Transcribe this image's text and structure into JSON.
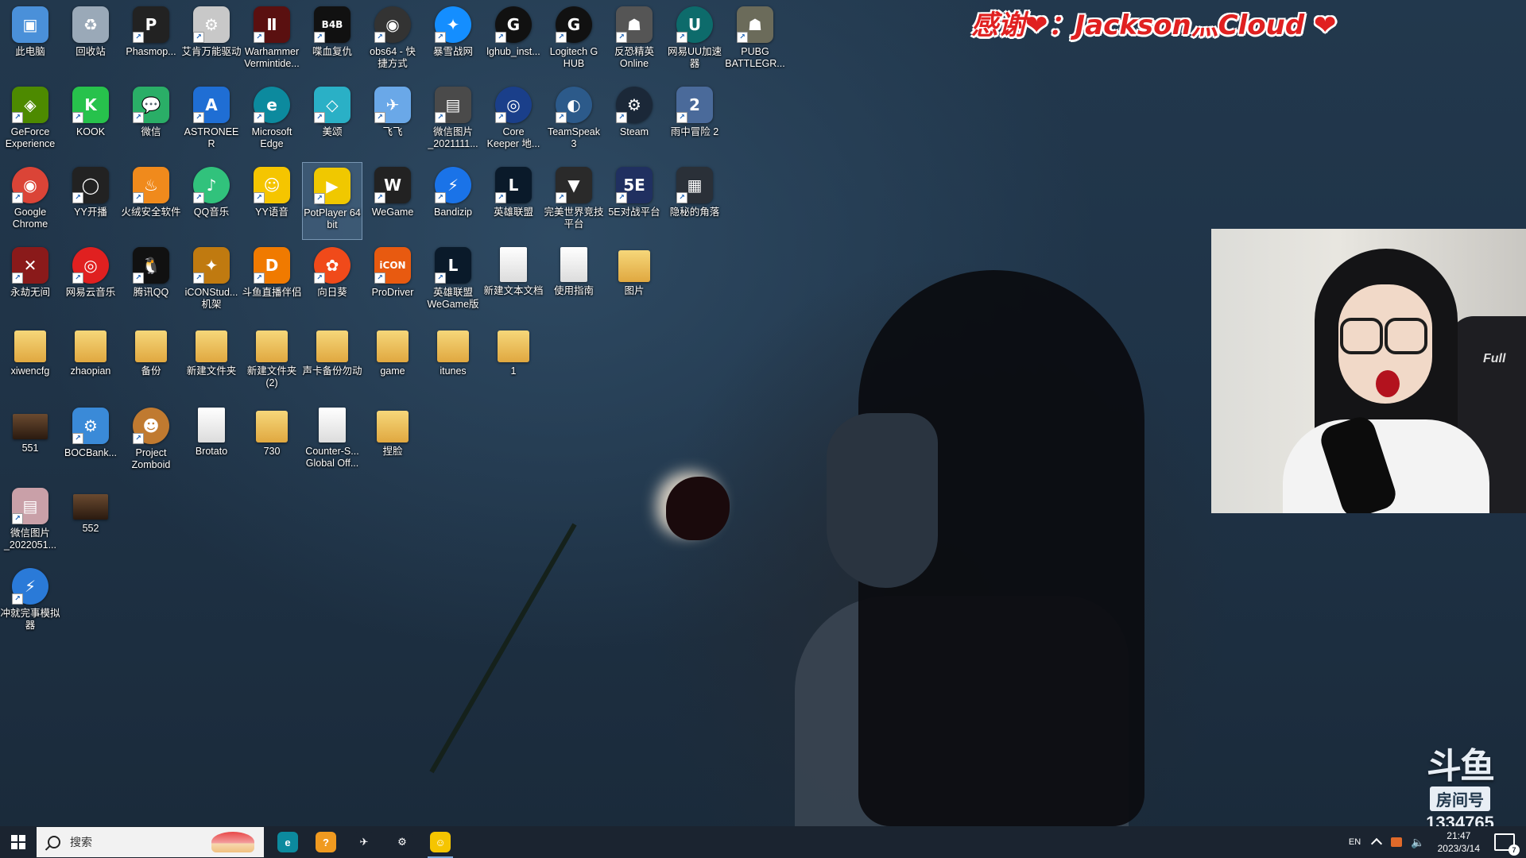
{
  "banner": {
    "text": "感谢❤：Jackson灬Cloud ❤"
  },
  "desktop": {
    "icons": [
      {
        "label": "此电脑",
        "c": "#4a90d9",
        "g": "▣",
        "col": 0,
        "row": 0
      },
      {
        "label": "回收站",
        "c": "#9aa9b8",
        "g": "♻",
        "col": 1,
        "row": 0
      },
      {
        "label": "Phasmop...",
        "c": "#222",
        "g": "P",
        "col": 2,
        "row": 0
      },
      {
        "label": "艾肯万能驱动",
        "c": "#c8c8c8",
        "g": "⚙",
        "col": 3,
        "row": 0
      },
      {
        "label": "Warhammer\nVermintide...",
        "c": "#5a1010",
        "g": "Ⅱ",
        "col": 4,
        "row": 0
      },
      {
        "label": "喋血复仇",
        "c": "#111",
        "g": "B4B",
        "col": 5,
        "row": 0
      },
      {
        "label": "obs64 - 快\n捷方式",
        "c": "#333",
        "g": "◉",
        "col": 6,
        "row": 0,
        "round": true
      },
      {
        "label": "暴雪战网",
        "c": "#148eff",
        "g": "✦",
        "col": 7,
        "row": 0,
        "round": true
      },
      {
        "label": "lghub_inst...",
        "c": "#111",
        "g": "G",
        "col": 8,
        "row": 0,
        "round": true
      },
      {
        "label": "Logitech G\nHUB",
        "c": "#111",
        "g": "G",
        "col": 9,
        "row": 0,
        "round": true
      },
      {
        "label": "反恐精英\nOnline",
        "c": "#555",
        "g": "☗",
        "col": 10,
        "row": 0
      },
      {
        "label": "网易UU加速\n器",
        "c": "#0d6b6b",
        "g": "U",
        "col": 11,
        "row": 0,
        "round": true
      },
      {
        "label": "PUBG\nBATTLEGR...",
        "c": "#6b6b5a",
        "g": "☗",
        "col": 12,
        "row": 0
      },
      {
        "label": "GeForce\nExperience",
        "c": "#4d8a00",
        "g": "◈",
        "col": 0,
        "row": 1
      },
      {
        "label": "KOOK",
        "c": "#27c24c",
        "g": "K",
        "col": 1,
        "row": 1
      },
      {
        "label": "微信",
        "c": "#2aae67",
        "g": "💬",
        "col": 2,
        "row": 1
      },
      {
        "label": "ASTRONEER",
        "c": "#1f6ed4",
        "g": "A",
        "col": 3,
        "row": 1
      },
      {
        "label": "Microsoft\nEdge",
        "c": "#0c8a9e",
        "g": "e",
        "col": 4,
        "row": 1,
        "round": true
      },
      {
        "label": "美颂",
        "c": "#2ab0c6",
        "g": "◇",
        "col": 5,
        "row": 1
      },
      {
        "label": "飞飞",
        "c": "#6aa8e8",
        "g": "✈",
        "col": 6,
        "row": 1
      },
      {
        "label": "微信图片\n_2021111...",
        "c": "#4a4a4a",
        "g": "▤",
        "col": 7,
        "row": 1
      },
      {
        "label": "Core\nKeeper 地...",
        "c": "#1a3f8a",
        "g": "◎",
        "col": 8,
        "row": 1,
        "round": true
      },
      {
        "label": "TeamSpeak\n3",
        "c": "#2c5a8a",
        "g": "◐",
        "col": 9,
        "row": 1,
        "round": true
      },
      {
        "label": "Steam",
        "c": "#1b2838",
        "g": "⚙",
        "col": 10,
        "row": 1,
        "round": true
      },
      {
        "label": "雨中冒险 2",
        "c": "#4a6a9a",
        "g": "2",
        "col": 11,
        "row": 1
      },
      {
        "label": "Google\nChrome",
        "c": "#db4437",
        "g": "◉",
        "col": 0,
        "row": 2,
        "round": true
      },
      {
        "label": "YY开播",
        "c": "#222",
        "g": "◯",
        "col": 1,
        "row": 2
      },
      {
        "label": "火绒安全软件",
        "c": "#f08a1c",
        "g": "♨",
        "col": 2,
        "row": 2
      },
      {
        "label": "QQ音乐",
        "c": "#31c27c",
        "g": "♪",
        "col": 3,
        "row": 2,
        "round": true
      },
      {
        "label": "YY语音",
        "c": "#f5c500",
        "g": "☺",
        "col": 4,
        "row": 2
      },
      {
        "label": "PotPlayer 64\nbit",
        "c": "#f0c800",
        "g": "▶",
        "col": 5,
        "row": 2,
        "selected": true
      },
      {
        "label": "WeGame",
        "c": "#222",
        "g": "W",
        "col": 6,
        "row": 2
      },
      {
        "label": "Bandizip",
        "c": "#1a73e8",
        "g": "⚡",
        "col": 7,
        "row": 2,
        "round": true
      },
      {
        "label": "英雄联盟",
        "c": "#0a1a2a",
        "g": "L",
        "col": 8,
        "row": 2
      },
      {
        "label": "完美世界竞技\n平台",
        "c": "#2a2a2a",
        "g": "▼",
        "col": 9,
        "row": 2
      },
      {
        "label": "5E对战平台",
        "c": "#203060",
        "g": "5E",
        "col": 10,
        "row": 2
      },
      {
        "label": "隐秘的角落",
        "c": "#2a3038",
        "g": "▦",
        "col": 11,
        "row": 2
      },
      {
        "label": "永劫无间",
        "c": "#8a1a1a",
        "g": "✕",
        "col": 0,
        "row": 3
      },
      {
        "label": "网易云音乐",
        "c": "#e02020",
        "g": "◎",
        "col": 1,
        "row": 3,
        "round": true
      },
      {
        "label": "腾讯QQ",
        "c": "#111",
        "g": "🐧",
        "col": 2,
        "row": 3
      },
      {
        "label": "iCONStud...\n机架",
        "c": "#c07a10",
        "g": "✦",
        "col": 3,
        "row": 3
      },
      {
        "label": "斗鱼直播伴侣",
        "c": "#f07a00",
        "g": "D",
        "col": 4,
        "row": 3
      },
      {
        "label": "向日葵",
        "c": "#f04a1a",
        "g": "✿",
        "col": 5,
        "row": 3,
        "round": true
      },
      {
        "label": "ProDriver",
        "c": "#e85a10",
        "g": "iCON",
        "col": 6,
        "row": 3
      },
      {
        "label": "英雄联盟\nWeGame版",
        "c": "#0a1a2a",
        "g": "L",
        "col": 7,
        "row": 3
      },
      {
        "label": "新建文本文档",
        "c": "#f4f4f4",
        "g": "",
        "col": 8,
        "row": 3,
        "file": true
      },
      {
        "label": "使用指南",
        "c": "#f4f4f4",
        "g": "",
        "col": 9,
        "row": 3,
        "file": true
      },
      {
        "label": "图片",
        "c": "#e8c060",
        "g": "",
        "col": 10,
        "row": 3,
        "folder": true
      },
      {
        "label": "xiwencfg",
        "c": "#e8c060",
        "g": "",
        "col": 0,
        "row": 4,
        "folder": true
      },
      {
        "label": "zhaopian",
        "c": "#e8c060",
        "g": "",
        "col": 1,
        "row": 4,
        "folder": true
      },
      {
        "label": "备份",
        "c": "#e8c060",
        "g": "",
        "col": 2,
        "row": 4,
        "folder": true
      },
      {
        "label": "新建文件夹",
        "c": "#e8c060",
        "g": "",
        "col": 3,
        "row": 4,
        "folder": true
      },
      {
        "label": "新建文件夹\n(2)",
        "c": "#e8c060",
        "g": "",
        "col": 4,
        "row": 4,
        "folder": true
      },
      {
        "label": "声卡备份勿动",
        "c": "#e8c060",
        "g": "",
        "col": 5,
        "row": 4,
        "folder": true
      },
      {
        "label": "game",
        "c": "#e8c060",
        "g": "",
        "col": 6,
        "row": 4,
        "folder": true
      },
      {
        "label": "itunes",
        "c": "#e8c060",
        "g": "",
        "col": 7,
        "row": 4,
        "folder": true
      },
      {
        "label": "1",
        "c": "#e8c060",
        "g": "",
        "col": 8,
        "row": 4,
        "folder": true
      },
      {
        "label": "551",
        "c": "#5a3a20",
        "g": "",
        "col": 0,
        "row": 5,
        "photo": true
      },
      {
        "label": "BOCBank...",
        "c": "#3a8ad8",
        "g": "⚙",
        "col": 1,
        "row": 5
      },
      {
        "label": "Project\nZomboid",
        "c": "#c07a30",
        "g": "☻",
        "col": 2,
        "row": 5,
        "round": true
      },
      {
        "label": "Brotato",
        "c": "#f4f4f4",
        "g": "",
        "col": 3,
        "row": 5,
        "file": true
      },
      {
        "label": "730",
        "c": "#e8c060",
        "g": "",
        "col": 4,
        "row": 5,
        "folder": true
      },
      {
        "label": "Counter-S...\nGlobal Off...",
        "c": "#f4f4f4",
        "g": "",
        "col": 5,
        "row": 5,
        "file": true
      },
      {
        "label": "捏脸",
        "c": "#e8c060",
        "g": "",
        "col": 6,
        "row": 5,
        "folder": true
      },
      {
        "label": "微信图片\n_2022051...",
        "c": "#c9a0a8",
        "g": "▤",
        "col": 0,
        "row": 6
      },
      {
        "label": "552",
        "c": "#3a2a20",
        "g": "",
        "col": 1,
        "row": 6,
        "photo": true
      },
      {
        "label": "冲就完事模拟\n器",
        "c": "#2a7ad8",
        "g": "⚡",
        "col": 0,
        "row": 7,
        "round": true
      }
    ]
  },
  "douyu": {
    "mark": "斗鱼",
    "room_label": "房间号",
    "room_number": "1334765"
  },
  "taskbar": {
    "search_placeholder": "搜索",
    "apps": [
      {
        "name": "edge-taskbar-icon",
        "c": "#0c8a9e",
        "g": "e"
      },
      {
        "name": "app-taskbar-icon",
        "c": "#f09a20",
        "g": "?"
      },
      {
        "name": "bird-taskbar-icon",
        "c": "#1b2430",
        "g": "✈"
      },
      {
        "name": "steam-taskbar-icon",
        "c": "#1b2430",
        "g": "⚙"
      },
      {
        "name": "yy-taskbar-icon",
        "c": "#f5c500",
        "g": "☺",
        "active": true
      }
    ],
    "lang": "EN",
    "time": "21:47",
    "date": "2023/3/14",
    "notif_count": "7"
  }
}
